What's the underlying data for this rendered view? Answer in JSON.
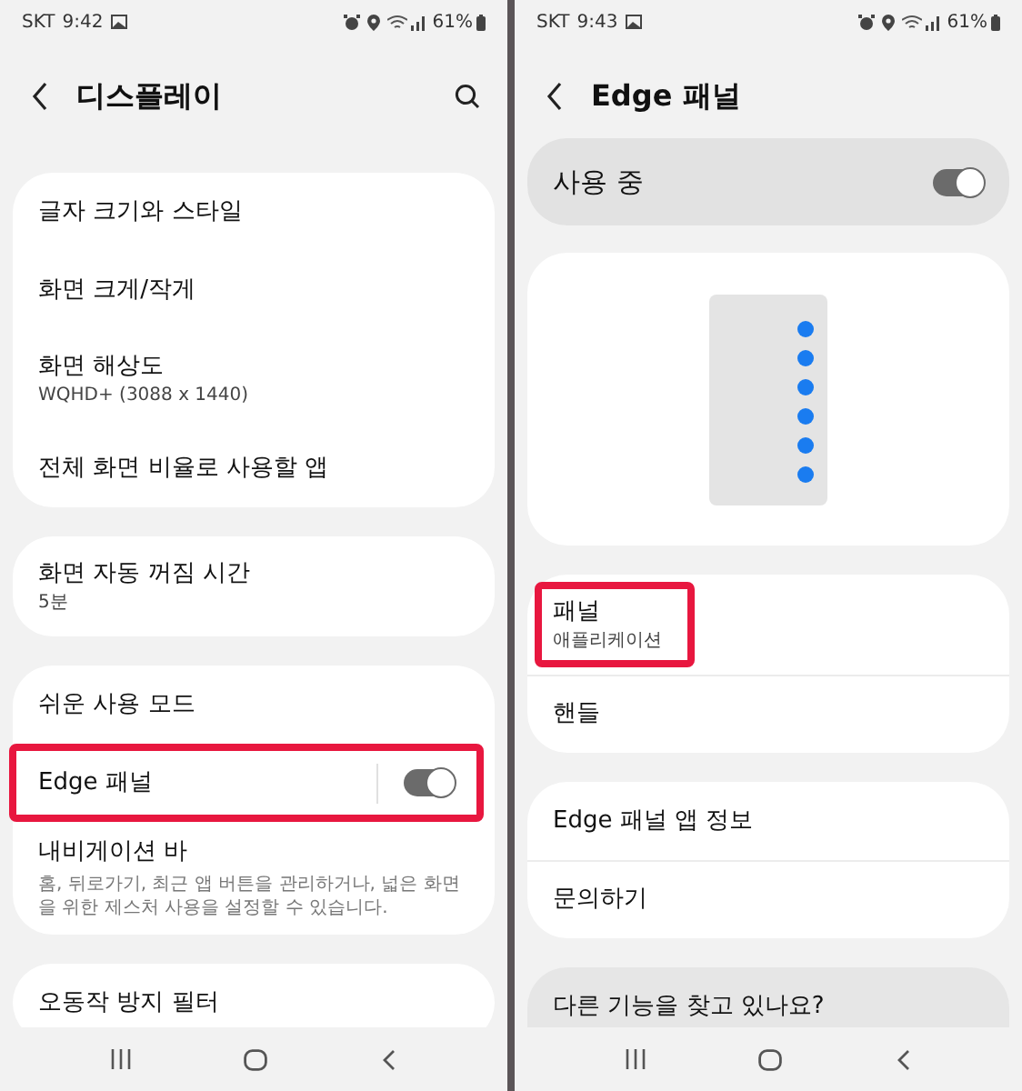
{
  "screens": [
    {
      "status_bar": {
        "carrier": "SKT",
        "time": "9:42",
        "battery": "61%"
      },
      "title": "디스플레이",
      "search": true,
      "groups": [
        {
          "kind": "card",
          "items": [
            {
              "kind": "plain",
              "title": "글자 크기와 스타일",
              "highlighted": false
            },
            {
              "kind": "plain",
              "title": "화면 크게/작게",
              "highlighted": false
            },
            {
              "kind": "plain",
              "title": "화면 해상도",
              "subtitle": "WQHD+ (3088 x 1440)",
              "highlighted": false
            },
            {
              "kind": "plain",
              "title": "전체 화면 비율로 사용할 앱",
              "highlighted": false
            }
          ]
        },
        {
          "kind": "card",
          "items": [
            {
              "kind": "plain",
              "title": "화면 자동 꺼짐 시간",
              "subtitle": "5분",
              "highlighted": false
            }
          ]
        },
        {
          "kind": "card",
          "items": [
            {
              "kind": "plain",
              "title": "쉬운 사용 모드",
              "highlighted": false
            },
            {
              "kind": "toggle",
              "title": "Edge 패널",
              "on": true,
              "highlighted": true
            },
            {
              "kind": "plain",
              "title": "내비게이션 바",
              "description": "홈, 뒤로가기, 최근 앱 버튼을 관리하거나, 넓은 화면을 위한 제스처 사용을 설정할 수 있습니다.",
              "highlighted": false
            }
          ]
        },
        {
          "kind": "card",
          "items": [
            {
              "kind": "plain",
              "title": "오동작 방지 필터",
              "highlighted": false
            }
          ]
        }
      ]
    },
    {
      "status_bar": {
        "carrier": "SKT",
        "time": "9:43",
        "battery": "61%"
      },
      "title": "Edge 패널",
      "search": false,
      "groups": [
        {
          "kind": "master",
          "items": [
            {
              "kind": "toggle",
              "title": "사용 중",
              "on": true,
              "highlighted": false
            }
          ]
        },
        {
          "kind": "preview"
        },
        {
          "kind": "card",
          "items": [
            {
              "kind": "plain",
              "title": "패널",
              "subtitle": "애플리케이션",
              "highlighted": true
            },
            {
              "kind": "plain",
              "title": "핸들",
              "highlighted": false
            }
          ]
        },
        {
          "kind": "card",
          "items": [
            {
              "kind": "plain",
              "title": "Edge 패널 앱 정보",
              "highlighted": false
            },
            {
              "kind": "plain",
              "title": "문의하기",
              "highlighted": false
            }
          ]
        },
        {
          "kind": "tip",
          "items": [
            {
              "kind": "plain",
              "title": "다른 기능을 찾고 있나요?",
              "highlighted": false
            }
          ]
        }
      ]
    }
  ]
}
